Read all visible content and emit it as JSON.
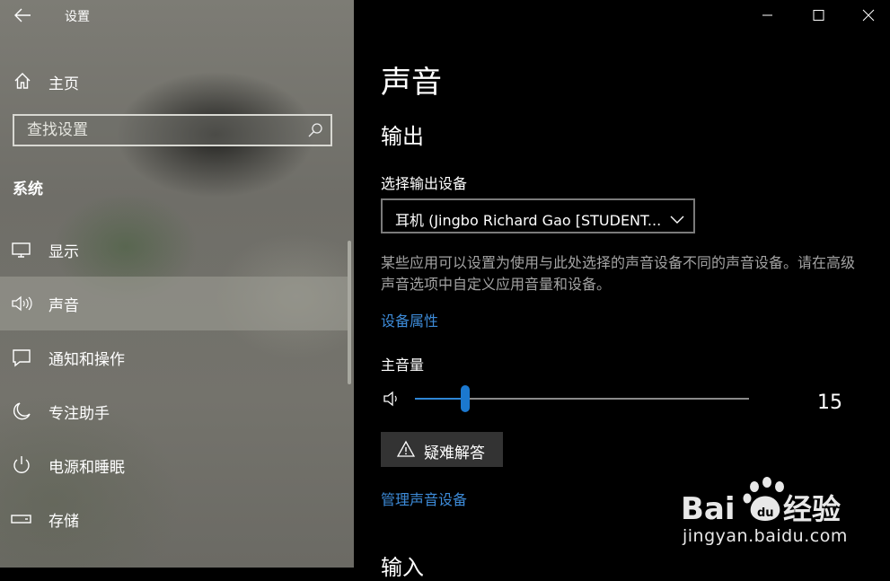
{
  "window": {
    "title": "设置"
  },
  "sidebar": {
    "home_label": "主页",
    "search_placeholder": "查找设置",
    "section": "系统",
    "items": [
      {
        "label": "显示",
        "icon": "display-icon"
      },
      {
        "label": "声音",
        "icon": "speaker-icon",
        "selected": true
      },
      {
        "label": "通知和操作",
        "icon": "notification-icon"
      },
      {
        "label": "专注助手",
        "icon": "moon-icon"
      },
      {
        "label": "电源和睡眠",
        "icon": "power-icon"
      },
      {
        "label": "存储",
        "icon": "storage-icon"
      }
    ]
  },
  "content": {
    "title": "声音",
    "output_heading": "输出",
    "select_label": "选择输出设备",
    "device": "耳机 (Jingbo Richard Gao [STUDENT...",
    "description": "某些应用可以设置为使用与此处选择的声音设备不同的声音设备。请在高级声音选项中自定义应用音量和设备。",
    "device_props": "设备属性",
    "volume_label": "主音量",
    "volume": 15,
    "volume_fraction": 0.15,
    "troubleshoot": "疑难解答",
    "manage": "管理声音设备",
    "input_heading": "输入"
  },
  "watermark": {
    "brand": "Bai 经验",
    "url": "jingyan.baidu.com"
  },
  "colors": {
    "accent": "#1b78cf",
    "link": "#3d8bd8",
    "content_bg": "#000000"
  }
}
